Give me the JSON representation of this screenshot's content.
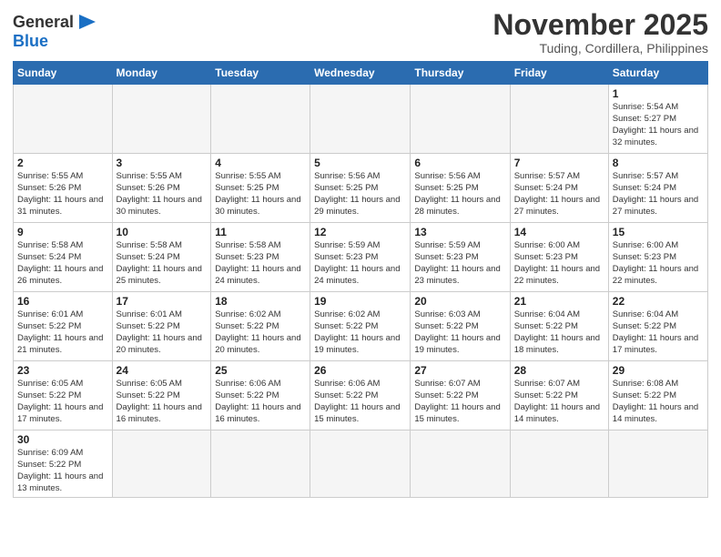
{
  "logo": {
    "text_general": "General",
    "text_blue": "Blue"
  },
  "header": {
    "month_title": "November 2025",
    "location": "Tuding, Cordillera, Philippines"
  },
  "weekdays": [
    "Sunday",
    "Monday",
    "Tuesday",
    "Wednesday",
    "Thursday",
    "Friday",
    "Saturday"
  ],
  "weeks": [
    [
      {
        "day": "",
        "info": ""
      },
      {
        "day": "",
        "info": ""
      },
      {
        "day": "",
        "info": ""
      },
      {
        "day": "",
        "info": ""
      },
      {
        "day": "",
        "info": ""
      },
      {
        "day": "",
        "info": ""
      },
      {
        "day": "1",
        "info": "Sunrise: 5:54 AM\nSunset: 5:27 PM\nDaylight: 11 hours\nand 32 minutes."
      }
    ],
    [
      {
        "day": "2",
        "info": "Sunrise: 5:55 AM\nSunset: 5:26 PM\nDaylight: 11 hours\nand 31 minutes."
      },
      {
        "day": "3",
        "info": "Sunrise: 5:55 AM\nSunset: 5:26 PM\nDaylight: 11 hours\nand 30 minutes."
      },
      {
        "day": "4",
        "info": "Sunrise: 5:55 AM\nSunset: 5:25 PM\nDaylight: 11 hours\nand 30 minutes."
      },
      {
        "day": "5",
        "info": "Sunrise: 5:56 AM\nSunset: 5:25 PM\nDaylight: 11 hours\nand 29 minutes."
      },
      {
        "day": "6",
        "info": "Sunrise: 5:56 AM\nSunset: 5:25 PM\nDaylight: 11 hours\nand 28 minutes."
      },
      {
        "day": "7",
        "info": "Sunrise: 5:57 AM\nSunset: 5:24 PM\nDaylight: 11 hours\nand 27 minutes."
      },
      {
        "day": "8",
        "info": "Sunrise: 5:57 AM\nSunset: 5:24 PM\nDaylight: 11 hours\nand 27 minutes."
      }
    ],
    [
      {
        "day": "9",
        "info": "Sunrise: 5:58 AM\nSunset: 5:24 PM\nDaylight: 11 hours\nand 26 minutes."
      },
      {
        "day": "10",
        "info": "Sunrise: 5:58 AM\nSunset: 5:24 PM\nDaylight: 11 hours\nand 25 minutes."
      },
      {
        "day": "11",
        "info": "Sunrise: 5:58 AM\nSunset: 5:23 PM\nDaylight: 11 hours\nand 24 minutes."
      },
      {
        "day": "12",
        "info": "Sunrise: 5:59 AM\nSunset: 5:23 PM\nDaylight: 11 hours\nand 24 minutes."
      },
      {
        "day": "13",
        "info": "Sunrise: 5:59 AM\nSunset: 5:23 PM\nDaylight: 11 hours\nand 23 minutes."
      },
      {
        "day": "14",
        "info": "Sunrise: 6:00 AM\nSunset: 5:23 PM\nDaylight: 11 hours\nand 22 minutes."
      },
      {
        "day": "15",
        "info": "Sunrise: 6:00 AM\nSunset: 5:23 PM\nDaylight: 11 hours\nand 22 minutes."
      }
    ],
    [
      {
        "day": "16",
        "info": "Sunrise: 6:01 AM\nSunset: 5:22 PM\nDaylight: 11 hours\nand 21 minutes."
      },
      {
        "day": "17",
        "info": "Sunrise: 6:01 AM\nSunset: 5:22 PM\nDaylight: 11 hours\nand 20 minutes."
      },
      {
        "day": "18",
        "info": "Sunrise: 6:02 AM\nSunset: 5:22 PM\nDaylight: 11 hours\nand 20 minutes."
      },
      {
        "day": "19",
        "info": "Sunrise: 6:02 AM\nSunset: 5:22 PM\nDaylight: 11 hours\nand 19 minutes."
      },
      {
        "day": "20",
        "info": "Sunrise: 6:03 AM\nSunset: 5:22 PM\nDaylight: 11 hours\nand 19 minutes."
      },
      {
        "day": "21",
        "info": "Sunrise: 6:04 AM\nSunset: 5:22 PM\nDaylight: 11 hours\nand 18 minutes."
      },
      {
        "day": "22",
        "info": "Sunrise: 6:04 AM\nSunset: 5:22 PM\nDaylight: 11 hours\nand 17 minutes."
      }
    ],
    [
      {
        "day": "23",
        "info": "Sunrise: 6:05 AM\nSunset: 5:22 PM\nDaylight: 11 hours\nand 17 minutes."
      },
      {
        "day": "24",
        "info": "Sunrise: 6:05 AM\nSunset: 5:22 PM\nDaylight: 11 hours\nand 16 minutes."
      },
      {
        "day": "25",
        "info": "Sunrise: 6:06 AM\nSunset: 5:22 PM\nDaylight: 11 hours\nand 16 minutes."
      },
      {
        "day": "26",
        "info": "Sunrise: 6:06 AM\nSunset: 5:22 PM\nDaylight: 11 hours\nand 15 minutes."
      },
      {
        "day": "27",
        "info": "Sunrise: 6:07 AM\nSunset: 5:22 PM\nDaylight: 11 hours\nand 15 minutes."
      },
      {
        "day": "28",
        "info": "Sunrise: 6:07 AM\nSunset: 5:22 PM\nDaylight: 11 hours\nand 14 minutes."
      },
      {
        "day": "29",
        "info": "Sunrise: 6:08 AM\nSunset: 5:22 PM\nDaylight: 11 hours\nand 14 minutes."
      }
    ],
    [
      {
        "day": "30",
        "info": "Sunrise: 6:09 AM\nSunset: 5:22 PM\nDaylight: 11 hours\nand 13 minutes."
      },
      {
        "day": "",
        "info": ""
      },
      {
        "day": "",
        "info": ""
      },
      {
        "day": "",
        "info": ""
      },
      {
        "day": "",
        "info": ""
      },
      {
        "day": "",
        "info": ""
      },
      {
        "day": "",
        "info": ""
      }
    ]
  ]
}
